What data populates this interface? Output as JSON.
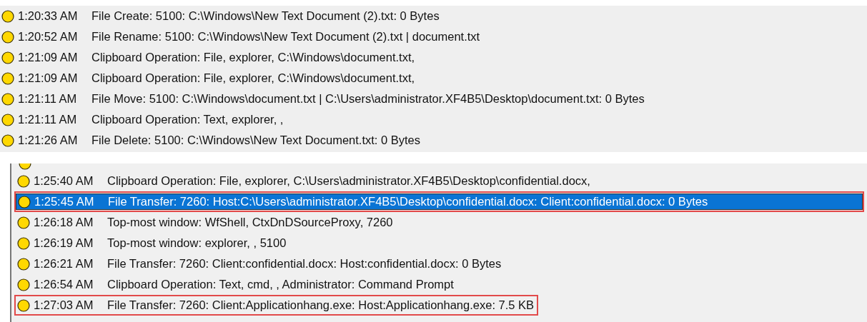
{
  "panels": [
    {
      "kind": "plain",
      "rows": [
        {
          "time": "1:20:33 AM",
          "message": "File Create: 5100: C:\\Windows\\New Text Document (2).txt: 0 Bytes",
          "selected": false,
          "outlined": false
        },
        {
          "time": "1:20:52 AM",
          "message": "File Rename: 5100: C:\\Windows\\New Text Document (2).txt | document.txt",
          "selected": false,
          "outlined": false
        },
        {
          "time": "1:21:09 AM",
          "message": "Clipboard Operation: File, explorer, C:\\Windows\\document.txt,",
          "selected": false,
          "outlined": false
        },
        {
          "time": "1:21:09 AM",
          "message": "Clipboard Operation: File, explorer, C:\\Windows\\document.txt,",
          "selected": false,
          "outlined": false
        },
        {
          "time": "1:21:11 AM",
          "message": "File Move: 5100: C:\\Windows\\document.txt | C:\\Users\\administrator.XF4B5\\Desktop\\document.txt: 0 Bytes",
          "selected": false,
          "outlined": false
        },
        {
          "time": "1:21:11 AM",
          "message": "Clipboard Operation: Text, explorer, ,",
          "selected": false,
          "outlined": false
        },
        {
          "time": "1:21:26 AM",
          "message": "File Delete: 5100: C:\\Windows\\New Text Document.txt: 0 Bytes",
          "selected": false,
          "outlined": false
        }
      ]
    },
    {
      "kind": "bordered",
      "rows": [
        {
          "time": "1:25:40 AM",
          "message": "Clipboard Operation: File, explorer, C:\\Users\\administrator.XF4B5\\Desktop\\confidential.docx,",
          "selected": false,
          "outlined": false
        },
        {
          "time": "1:25:45 AM",
          "message": "File Transfer: 7260: Host:C:\\Users\\administrator.XF4B5\\Desktop\\confidential.docx: Client:confidential.docx: 0 Bytes",
          "selected": true,
          "outlined": true
        },
        {
          "time": "1:26:18 AM",
          "message": "Top-most window: WfShell, CtxDnDSourceProxy, 7260",
          "selected": false,
          "outlined": false
        },
        {
          "time": "1:26:19 AM",
          "message": "Top-most window: explorer, , 5100",
          "selected": false,
          "outlined": false
        },
        {
          "time": "1:26:21 AM",
          "message": "File Transfer: 7260: Client:confidential.docx: Host:confidential.docx: 0 Bytes",
          "selected": false,
          "outlined": false
        },
        {
          "time": "1:26:54 AM",
          "message": "Clipboard Operation: Text, cmd, , Administrator: Command Prompt",
          "selected": false,
          "outlined": false
        },
        {
          "time": "1:27:03 AM",
          "message": "File Transfer: 7260: Client:Applicationhang.exe: Host:Applicationhang.exe: 7.5 KB",
          "selected": false,
          "outlined": true
        }
      ]
    }
  ]
}
